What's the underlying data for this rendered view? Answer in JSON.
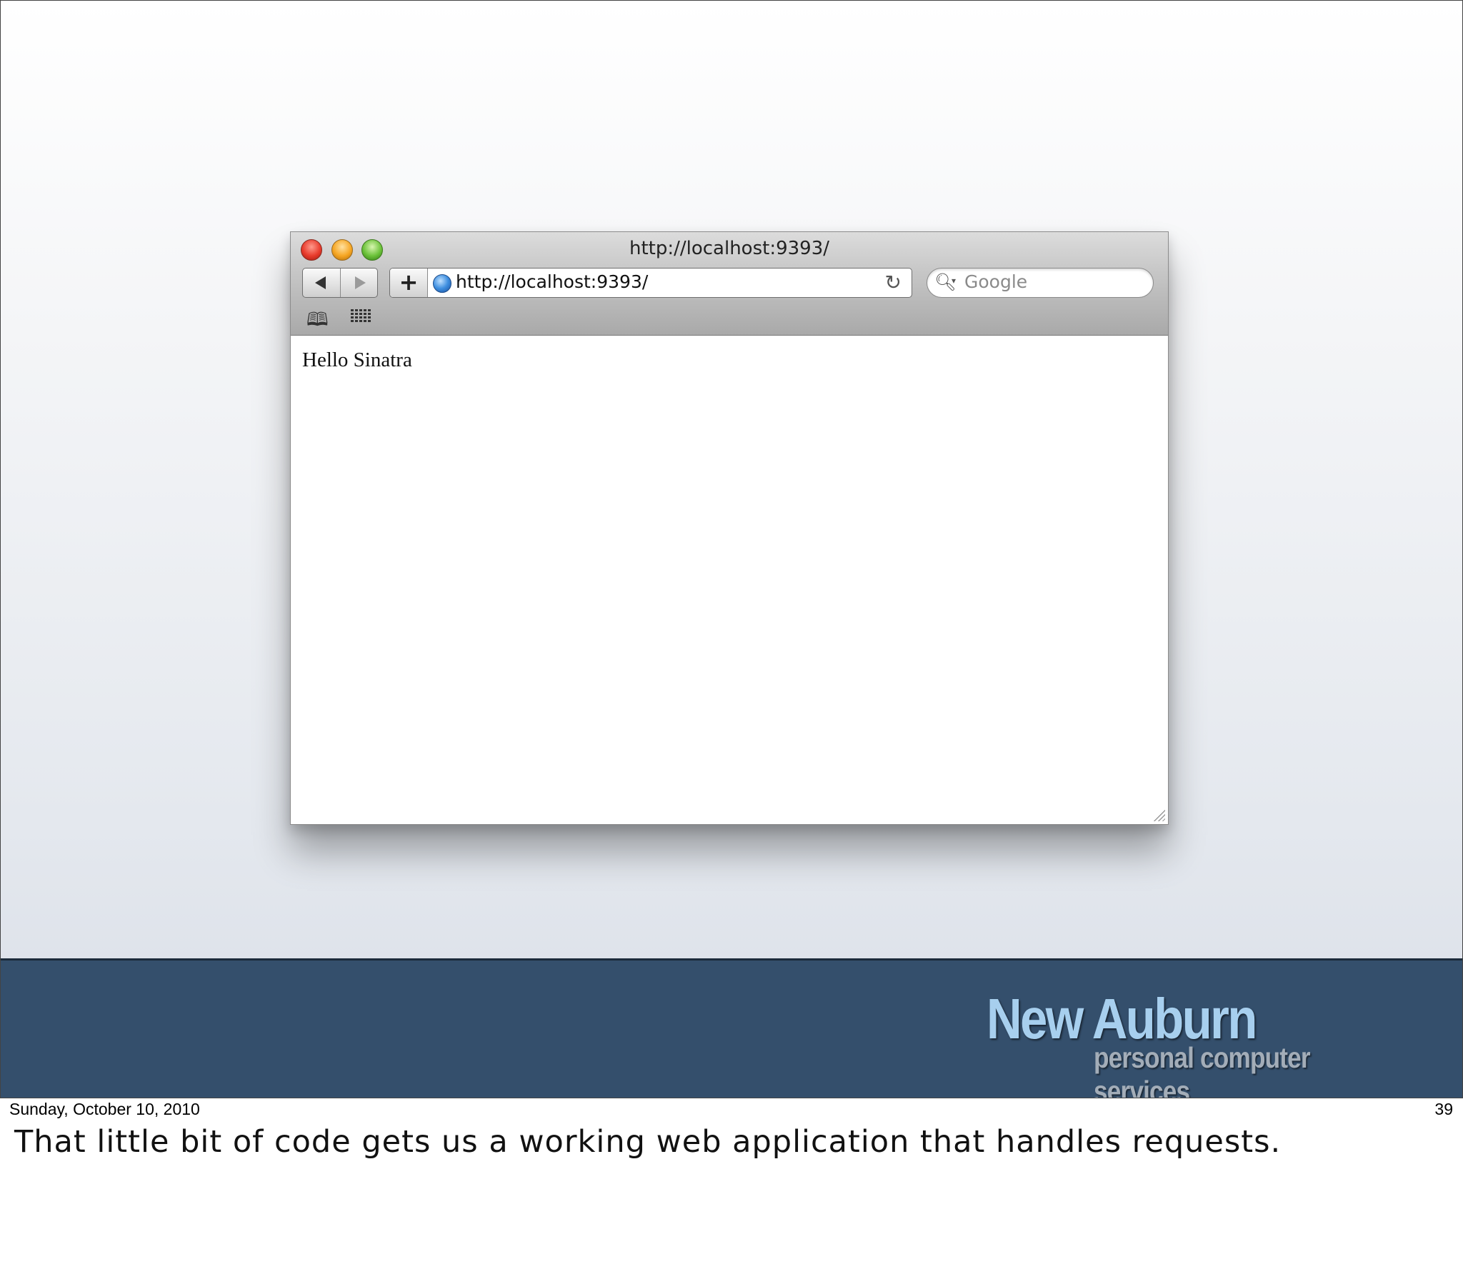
{
  "browser": {
    "window_title": "http://localhost:9393/",
    "address_url": "http://localhost:9393/",
    "add_bookmark_label": "+",
    "search_placeholder": "Google",
    "page_content": "Hello Sinatra",
    "icons": [
      "back-icon",
      "forward-icon",
      "globe-icon",
      "reload-icon",
      "search-icon",
      "bookmarks-book-icon",
      "top-sites-grid-icon",
      "resize-grip-icon"
    ]
  },
  "logo": {
    "name": "New Auburn",
    "tagline": "personal computer services"
  },
  "footer": {
    "date": "Sunday, October 10, 2010",
    "page_number": "39"
  },
  "notes": {
    "text": "That little bit of code gets us a working web application that handles requests."
  },
  "colors": {
    "footer_band": "#344f6c",
    "logo_main": "#a7cfee",
    "logo_sub": "#a3adb8"
  }
}
